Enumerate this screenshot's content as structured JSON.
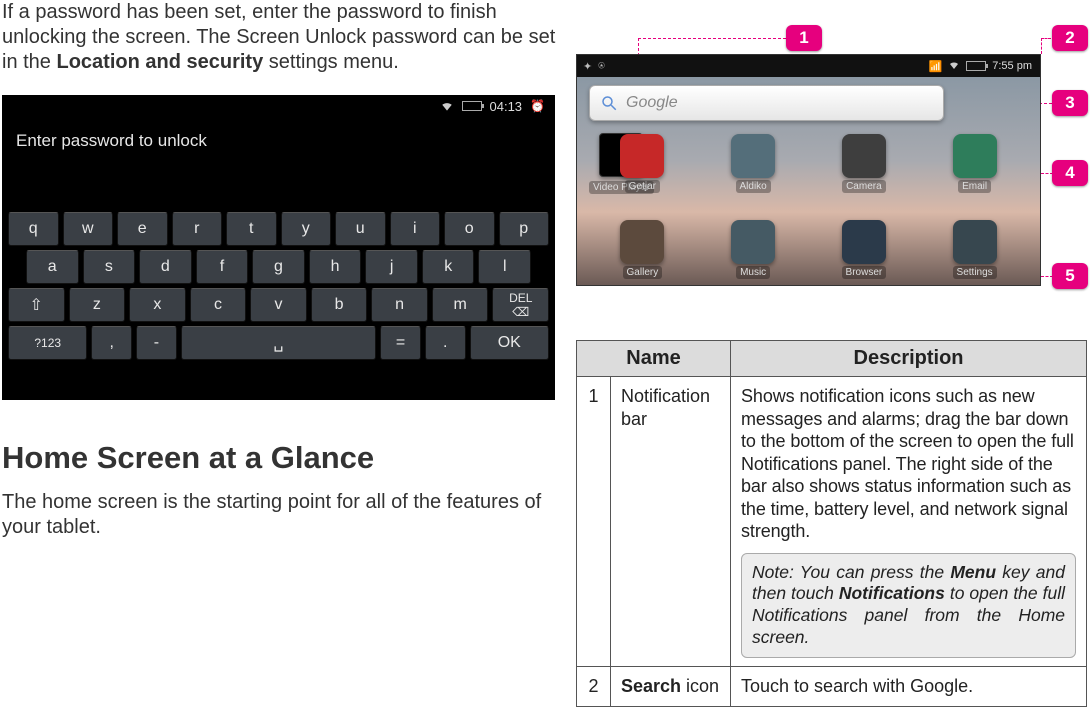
{
  "intro": {
    "pre": "If a password has been set, enter the password to finish unlocking the screen. The Screen Unlock password can be set in the ",
    "bold": "Location and security",
    "post": " settings menu."
  },
  "unlock": {
    "time": "04:13",
    "prompt": "Enter password to unlock",
    "rows": [
      [
        "q",
        "w",
        "e",
        "r",
        "t",
        "y",
        "u",
        "i",
        "o",
        "p"
      ],
      [
        "a",
        "s",
        "d",
        "f",
        "g",
        "h",
        "j",
        "k",
        "l"
      ],
      [
        "⇧",
        "z",
        "x",
        "c",
        "v",
        "b",
        "n",
        "m",
        "DEL\n⌫"
      ]
    ],
    "bottom": {
      "sym": "?123",
      "comma": ",",
      "dash": "-",
      "space": "␣",
      "eq": "=",
      "dot": ".",
      "ok": "OK"
    }
  },
  "heading": "Home Screen at a Glance",
  "sub": "The home screen is the starting point for all of the features of your tablet.",
  "homescreen": {
    "time": "7:55 pm",
    "search_placeholder": "Google",
    "video_player_label": "Video Player",
    "row1": [
      {
        "label": "Getjar",
        "color": "#c62828"
      },
      {
        "label": "Aldiko",
        "color": "#546e7a"
      },
      {
        "label": "Camera",
        "color": "#3e3e3e"
      },
      {
        "label": "Email",
        "color": "#2e7d5b"
      }
    ],
    "row2": [
      {
        "label": "Gallery",
        "color": "#5c4a3d"
      },
      {
        "label": "Music",
        "color": "#455a64"
      },
      {
        "label": "Browser",
        "color": "#2b3a4a"
      },
      {
        "label": "Settings",
        "color": "#37474f"
      }
    ]
  },
  "badges": [
    "1",
    "2",
    "3",
    "4",
    "5"
  ],
  "table": {
    "head": {
      "name": "Name",
      "desc": "Description"
    },
    "rows": [
      {
        "num": "1",
        "name": "Notification bar",
        "desc": "Shows notification icons such as new messages and alarms; drag the bar down to the bottom of the screen to open the full Notifications panel. The right side of the bar also shows status information such as the time, battery level, and network signal strength.",
        "note": {
          "pre": "Note: You can press the ",
          "b1": "Menu",
          "mid": " key and then touch ",
          "b2": "Notifications",
          "post": " to open the full Notifications panel from the Home screen."
        }
      },
      {
        "num": "2",
        "name_bold": "Search",
        "name_plain": " icon",
        "desc": "Touch to search with Google."
      }
    ]
  }
}
